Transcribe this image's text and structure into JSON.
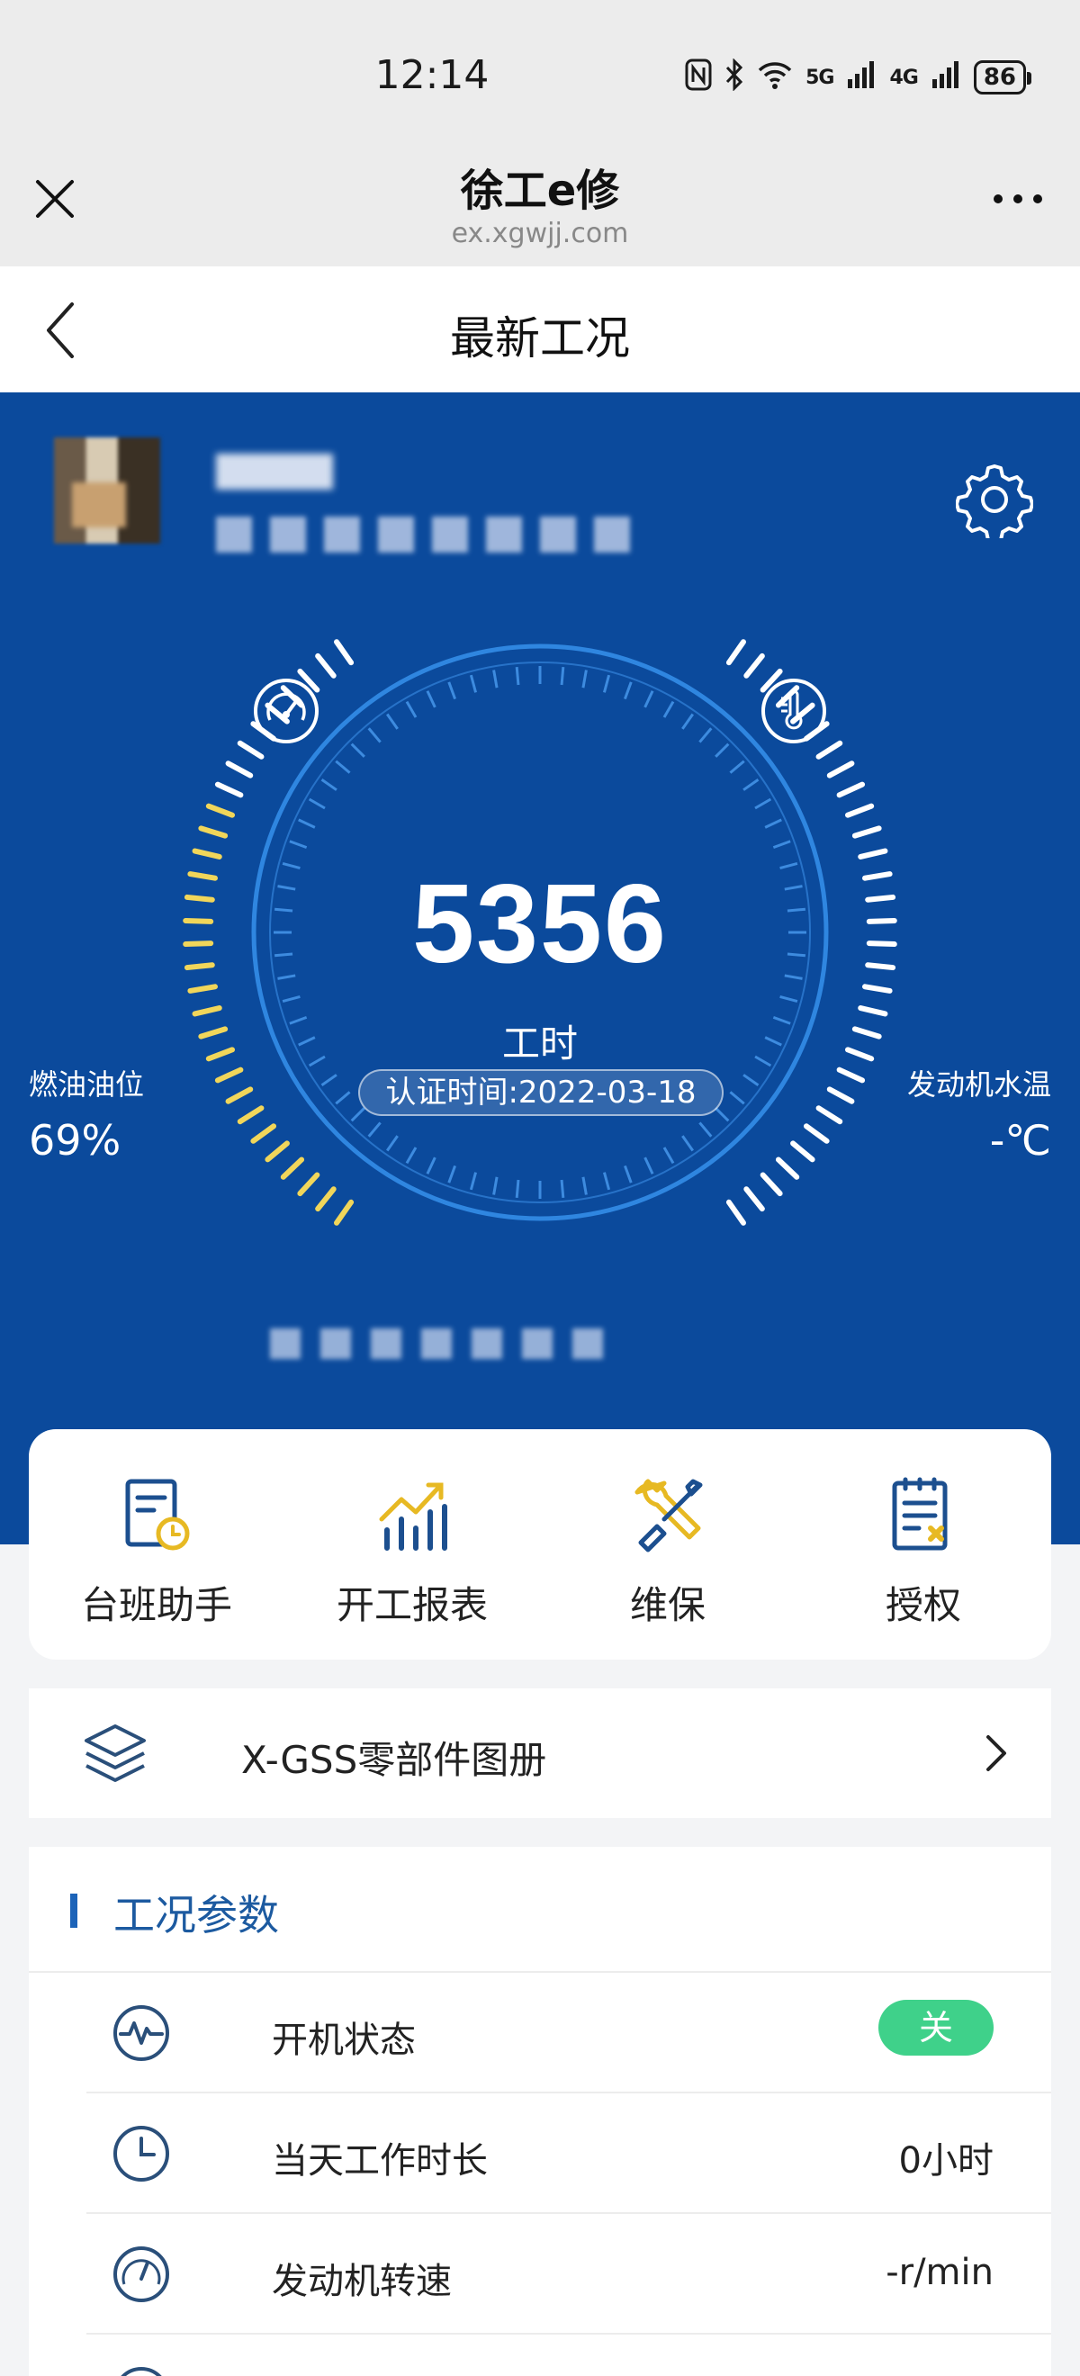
{
  "status_bar": {
    "time": "12:14",
    "signal_5g": "5G",
    "signal_4g": "4G",
    "battery": "86"
  },
  "browser": {
    "title": "徐工e修",
    "url": "ex.xgwjj.com"
  },
  "page": {
    "title": "最新工况"
  },
  "hero": {
    "hours_value": "5356",
    "hours_unit": "工时",
    "cert_time": "认证时间:2022-03-18",
    "fuel_label": "燃油油位",
    "fuel_value": "69%",
    "fuel_level": 0.69,
    "temp_label": "发动机水温",
    "temp_value": "-℃",
    "colors": {
      "background": "#0b4a9c",
      "fuel_fill": "#f1d65a",
      "tick_unfilled": "#ffffff"
    }
  },
  "actions": [
    {
      "label": "台班助手",
      "icon": "shift-report-icon"
    },
    {
      "label": "开工报表",
      "icon": "bar-chart-icon"
    },
    {
      "label": "维保",
      "icon": "wrench-icon"
    },
    {
      "label": "授权",
      "icon": "authorize-document-icon"
    }
  ],
  "catalog": {
    "label": "X-GSS零部件图册",
    "icon": "layers-icon"
  },
  "params": {
    "title": "工况参数",
    "rows": [
      {
        "label": "开机状态",
        "value": "关",
        "icon": "pulse-icon"
      },
      {
        "label": "当天工作时长",
        "value": "0小时",
        "icon": "clock-icon"
      },
      {
        "label": "发动机转速",
        "value": "-r/min",
        "icon": "tachometer-icon"
      }
    ]
  }
}
